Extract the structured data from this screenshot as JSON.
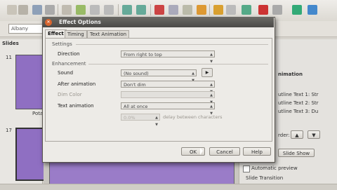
{
  "toolbar": {
    "font_name": "Albany"
  },
  "slides_panel": {
    "title": "Slides",
    "slides": [
      {
        "num": "11",
        "caption": "Pota"
      },
      {
        "num": "17",
        "caption": ""
      }
    ]
  },
  "taskpane": {
    "heading": "nimation",
    "effects": [
      "utline Text 1: Str",
      "utline Text 2: Str",
      "utline Text 3: Du"
    ],
    "order_label": "rder:",
    "slide_show_label": "Slide Show",
    "automatic_preview_label": "Automatic preview",
    "slide_transition_label": "Slide Transition"
  },
  "dialog": {
    "title": "Effect Options",
    "tabs": [
      "Effect",
      "Timing",
      "Text Animation"
    ],
    "sections": {
      "settings": "Settings",
      "enhancement": "Enhancement"
    },
    "direction": {
      "label": "Direction",
      "value": "From right to top"
    },
    "sound": {
      "label": "Sound",
      "value": "(No sound)"
    },
    "after_animation": {
      "label": "After animation",
      "value": "Don't dim"
    },
    "dim_color": {
      "label": "Dim Color",
      "value": ""
    },
    "text_animation": {
      "label": "Text animation",
      "value": "All at once"
    },
    "delay": {
      "value": "0.0%",
      "label": "delay between characters"
    },
    "buttons": {
      "ok": "OK",
      "cancel": "Cancel",
      "help": "Help"
    }
  },
  "colors": {
    "slide_fill": "#8f6fc2",
    "title_bar": "#4a4946",
    "close_button": "#d8652f"
  }
}
